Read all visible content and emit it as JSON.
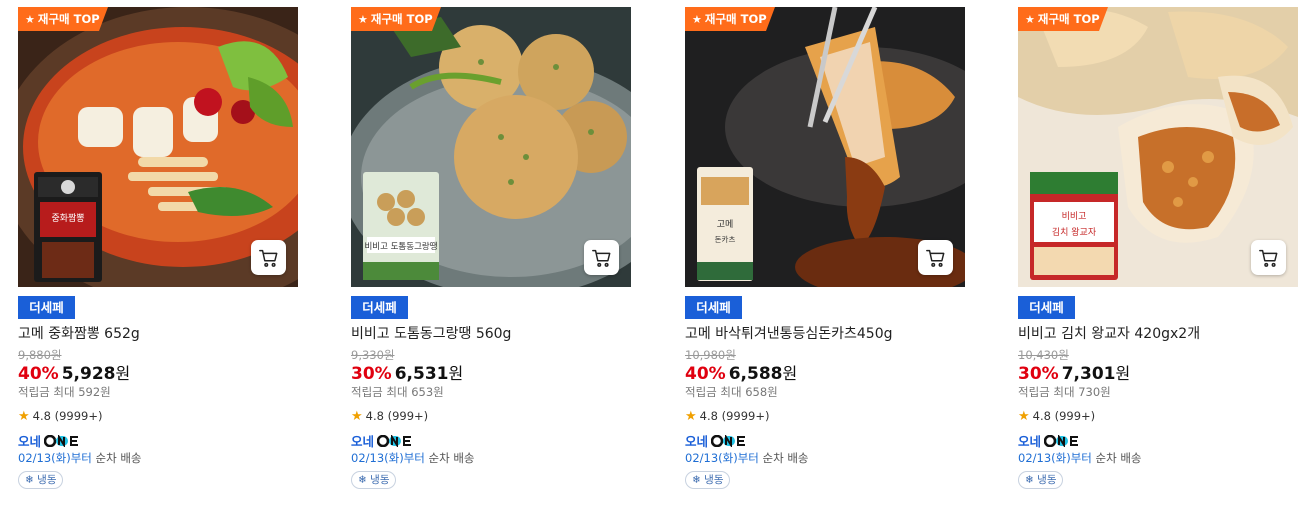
{
  "products": [
    {
      "top_badge": "재구매 TOP",
      "brand_logo_text": "더세페",
      "name": "고메 중화짬뽕 652g",
      "original_price": "9,880원",
      "discount": "40%",
      "price": "5,928",
      "price_unit": "원",
      "points": "적립금 최대 592원",
      "rating": "4.8",
      "review_count": "(9999+)",
      "delivery_label": "오네",
      "delivery_date": "02/13(화)부터",
      "delivery_suffix": " 순차 배송",
      "storage_tag": "냉동"
    },
    {
      "top_badge": "재구매 TOP",
      "brand_logo_text": "더세페",
      "name": "비비고 도톰동그랑땡 560g",
      "original_price": "9,330원",
      "discount": "30%",
      "price": "6,531",
      "price_unit": "원",
      "points": "적립금 최대 653원",
      "rating": "4.8",
      "review_count": "(999+)",
      "delivery_label": "오네",
      "delivery_date": "02/13(화)부터",
      "delivery_suffix": " 순차 배송",
      "storage_tag": "냉동"
    },
    {
      "top_badge": "재구매 TOP",
      "brand_logo_text": "더세페",
      "name": "고메 바삭튀겨낸통등심돈카츠450g",
      "original_price": "10,980원",
      "discount": "40%",
      "price": "6,588",
      "price_unit": "원",
      "points": "적립금 최대 658원",
      "rating": "4.8",
      "review_count": "(9999+)",
      "delivery_label": "오네",
      "delivery_date": "02/13(화)부터",
      "delivery_suffix": " 순차 배송",
      "storage_tag": "냉동"
    },
    {
      "top_badge": "재구매 TOP",
      "brand_logo_text": "더세페",
      "name": "비비고 김치 왕교자 420gx2개",
      "original_price": "10,430원",
      "discount": "30%",
      "price": "7,301",
      "price_unit": "원",
      "points": "적립금 최대 730원",
      "rating": "4.8",
      "review_count": "(999+)",
      "delivery_label": "오네",
      "delivery_date": "02/13(화)부터",
      "delivery_suffix": " 순차 배송",
      "storage_tag": "냉동"
    }
  ],
  "colors": {
    "badge_orange": "#ff6c1a",
    "discount_red": "#e0000f",
    "brand_blue": "#1a5fd8",
    "one_cyan": "#22c3e6"
  },
  "icons": {
    "cart": "cart-icon",
    "star": "star-icon",
    "snowflake": "snowflake-icon"
  }
}
